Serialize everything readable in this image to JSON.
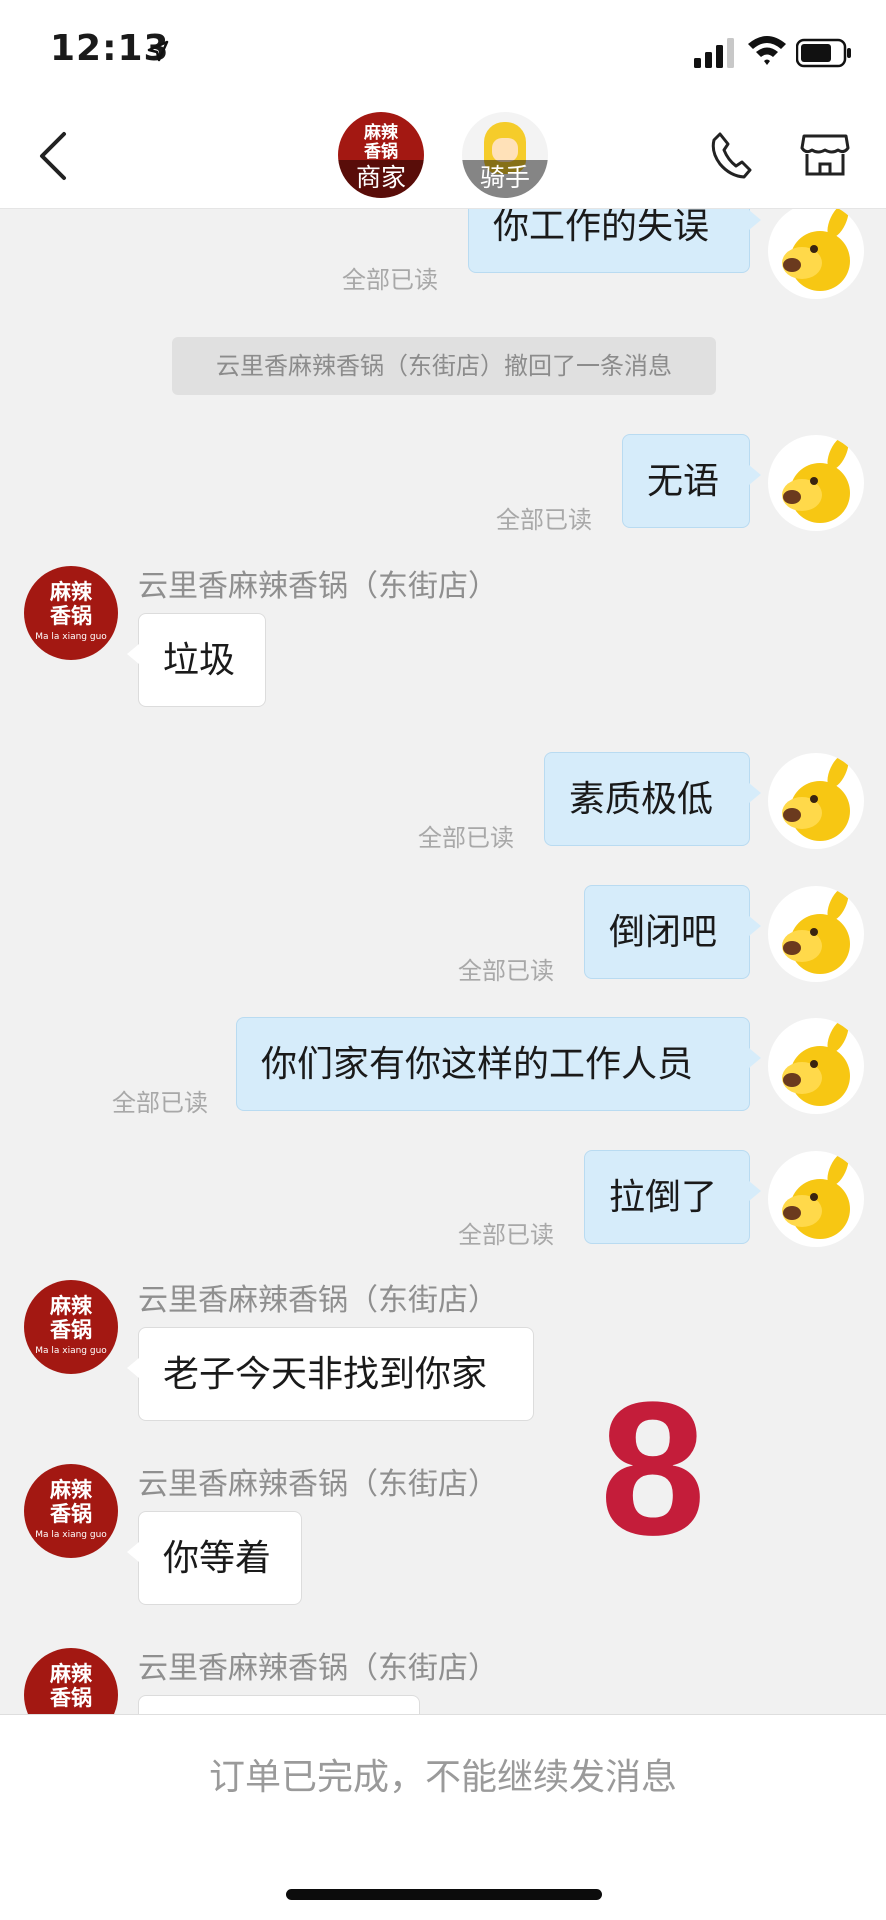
{
  "status_bar": {
    "time": "12:13"
  },
  "nav": {
    "merchant_logo": "麻辣\n香锅",
    "merchant_label": "商家",
    "rider_label": "骑手"
  },
  "chat": {
    "shop_name": "云里香麻辣香锅（东街店）",
    "shop_avatar_text": "麻辣\n香锅",
    "shop_avatar_sub": "Ma la xiang guo",
    "read_status": "全部已读",
    "recall_notice": "云里香麻辣香锅（东街店）撤回了一条消息",
    "messages": [
      {
        "from": "me",
        "text": "你工作的失误"
      },
      {
        "from": "me",
        "text": "无语"
      },
      {
        "from": "shop",
        "text": "垃圾"
      },
      {
        "from": "me",
        "text": "素质极低"
      },
      {
        "from": "me",
        "text": "倒闭吧"
      },
      {
        "from": "me",
        "text": "你们家有你这样的工作人员"
      },
      {
        "from": "me",
        "text": "拉倒了"
      },
      {
        "from": "shop",
        "text": "老子今天非找到你家"
      },
      {
        "from": "shop",
        "text": "你等着"
      },
      {
        "from": "shop",
        "text": ""
      }
    ]
  },
  "overlay_number": "8",
  "footer": {
    "text": "订单已完成，不能继续发消息"
  },
  "colors": {
    "outgoing_bubble": "#d6ecfa",
    "incoming_bubble": "#ffffff",
    "shop_brand": "#a31812",
    "overlay_number": "#c41d3a"
  }
}
